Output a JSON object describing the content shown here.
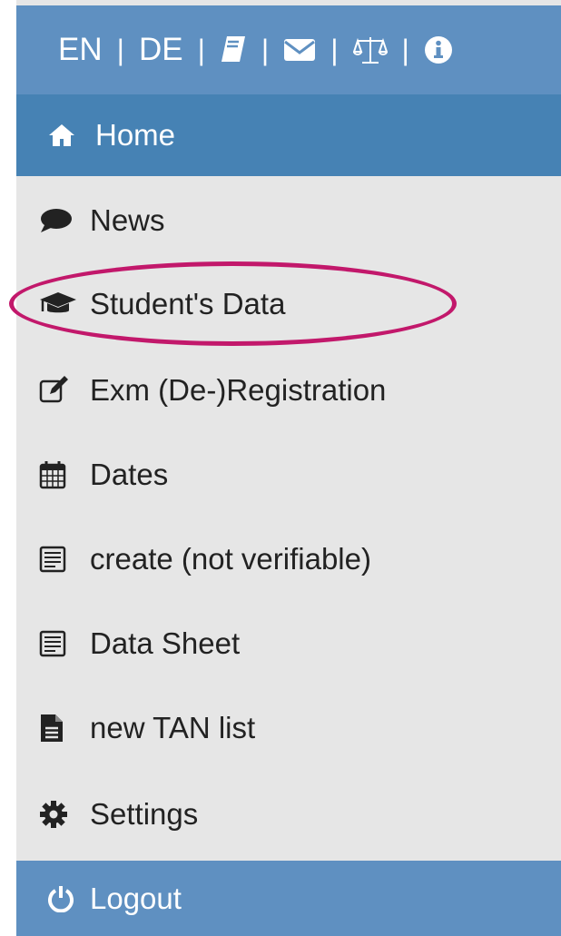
{
  "topbar": {
    "lang_en": "EN",
    "sep": "|",
    "lang_de": "DE",
    "icons": [
      "book-icon",
      "envelope-icon",
      "balance-scale-icon",
      "info-icon"
    ]
  },
  "nav": {
    "home": "Home",
    "items": [
      {
        "label": "News",
        "icon": "comment-icon"
      },
      {
        "label": "Student's Data",
        "icon": "graduation-cap-icon"
      },
      {
        "label": "Exm (De-)Registration",
        "icon": "edit-icon"
      },
      {
        "label": "Dates",
        "icon": "calendar-icon"
      },
      {
        "label": "create (not verifiable)",
        "icon": "list-document-icon"
      },
      {
        "label": "Data Sheet",
        "icon": "list-document-icon"
      },
      {
        "label": "new TAN list",
        "icon": "file-text-icon"
      },
      {
        "label": "Settings",
        "icon": "cog-icon"
      }
    ],
    "logout": "Logout"
  },
  "colors": {
    "topbar": "#5f90c1",
    "active": "#4682b4",
    "background": "#e6e6e6",
    "highlight": "#c2186b"
  }
}
